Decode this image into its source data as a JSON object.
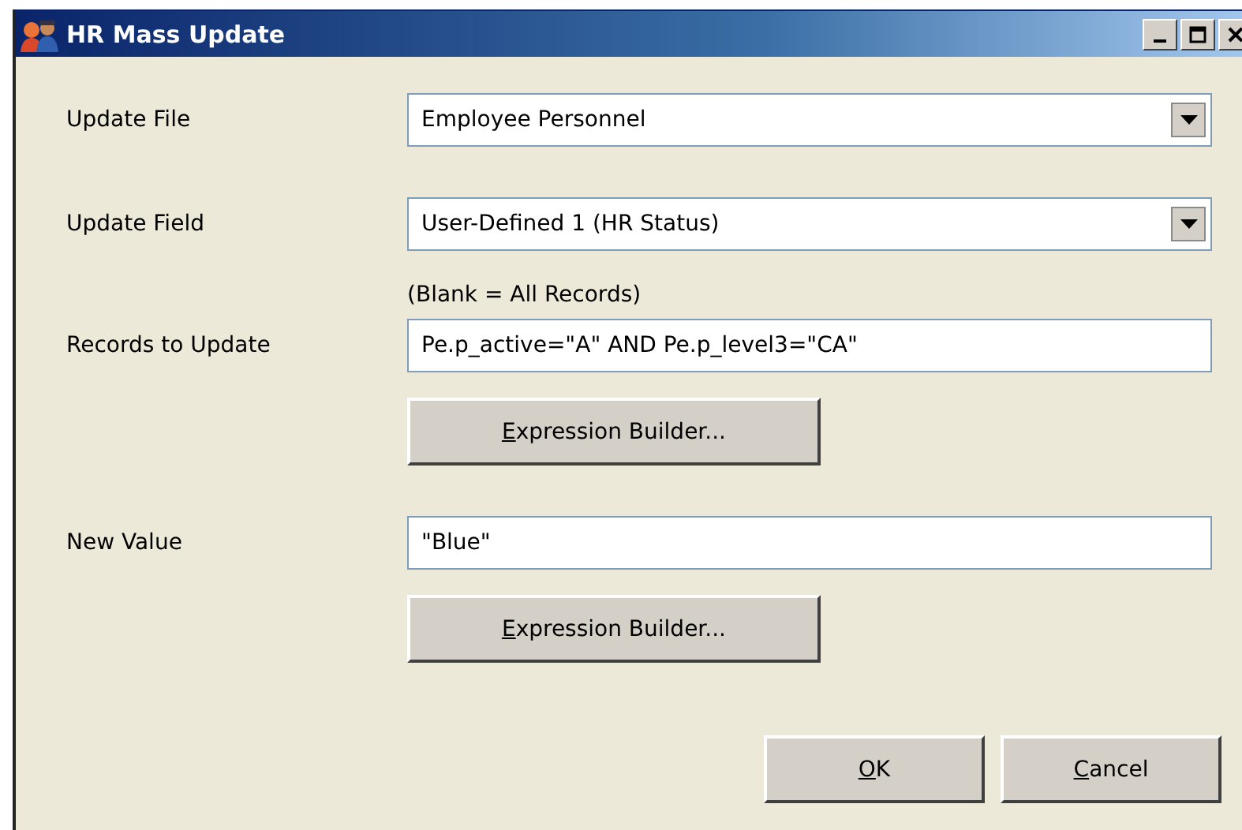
{
  "window": {
    "title": "HR Mass Update"
  },
  "rows": [
    {
      "kind": "dropdown",
      "label": "Update File",
      "value": "Employee Personnel"
    },
    {
      "kind": "dropdown",
      "label": "Update Field",
      "value": "User-Defined 1 (HR Status)"
    },
    {
      "kind": "text",
      "hint": "(Blank = All Records)",
      "label": "Records to Update",
      "value": "Pe.p_active=\"A\" AND  Pe.p_level3=\"CA\"",
      "button": {
        "label": "Expression Builder...",
        "mnemonic": true
      }
    },
    {
      "kind": "text",
      "label": "New Value",
      "value": "\"Blue\"",
      "button": {
        "label": "Expression Builder...",
        "mnemonic": true
      }
    }
  ],
  "buttons": [
    {
      "label": "OK",
      "mnemonic": true
    },
    {
      "label": "Cancel",
      "mnemonic": true
    }
  ]
}
